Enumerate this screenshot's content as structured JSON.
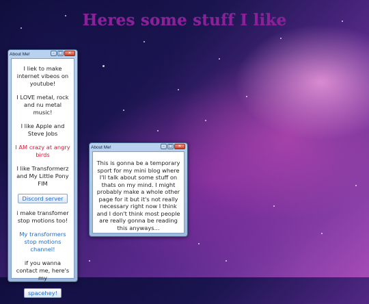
{
  "page": {
    "headline": "Heres some stuff I like"
  },
  "about_window": {
    "title": "About Me!",
    "paragraphs": {
      "p1": "I liek to make internet vibeos on youtube!",
      "p2": "I LOVE metal, rock and nu metal music!",
      "p3": "I like Apple and Steve Jobs",
      "p4": "I AM crazy at angry birds",
      "p5": "I like Transformerz and My Little Pony FIM",
      "p6": "i make transfomer stop motions too!",
      "p7": "My transformers stop motions channel!",
      "p8": "if you wanna contact me, here's my"
    },
    "discord_button": "Discord server",
    "spacehey_button": "spacehey!"
  },
  "blog_window": {
    "title": "About Me!",
    "body": "This is gonna be a temporary sport for my mini blog where I'll talk about some stuff on thats on my mind. I might probably make a whole other page for it but it's not really necessary right now I think and I don't think most people are really gonna be reading this anyways..."
  },
  "window_controls": {
    "minimize": "–",
    "maximize": "□",
    "close": "✕"
  },
  "colors": {
    "headline": "#8e1f9b",
    "highlight_red": "#e0152f",
    "link_blue": "#1a6ad1"
  }
}
